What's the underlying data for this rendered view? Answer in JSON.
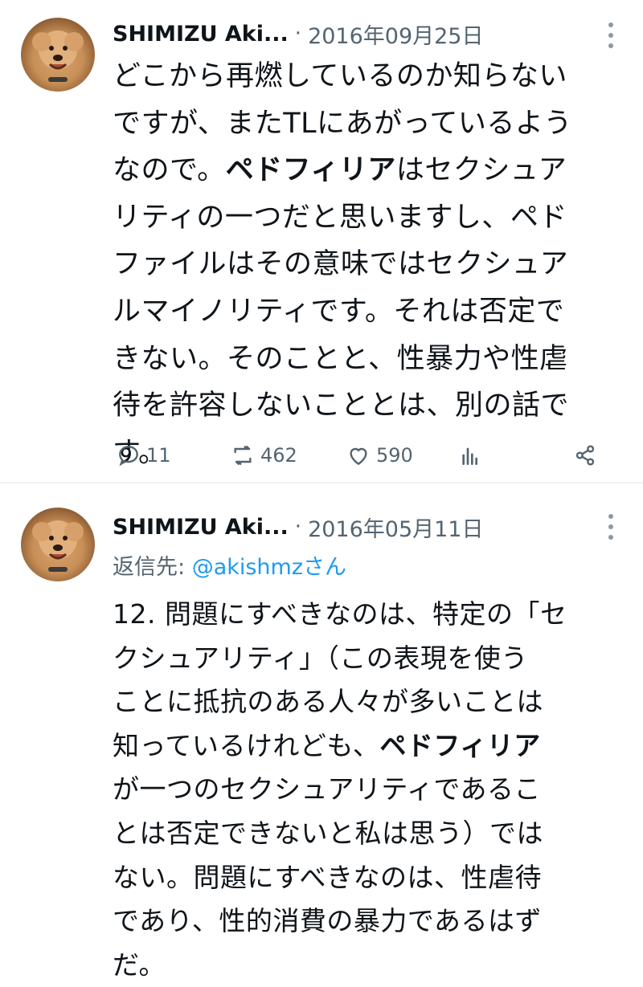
{
  "tweets": [
    {
      "author": "SHIMIZU Aki...",
      "separator": "·",
      "date": "2016年09月25日",
      "body_lines": [
        "どこから再燃しているのか知らない",
        "ですが、またTLにあがっているよう",
        "なので。ペドフィリアはセクシュア",
        "リティの一つだと思いますし、ペド",
        "ファイルはその意味ではセクシュア",
        "ルマイノリティです。それは否定で",
        "きない。そのことと、性暴力や性虐",
        "待を許容しないこととは、別の話で",
        "す。"
      ],
      "actions": {
        "replies": "11",
        "retweets": "462",
        "likes": "590"
      },
      "icons": [
        "reply-icon",
        "retweet-icon",
        "like-icon",
        "views-icon",
        "share-icon",
        "more-icon"
      ]
    },
    {
      "author": "SHIMIZU Aki...",
      "separator": "·",
      "date": "2016年05月11日",
      "reply_prefix": "返信先: ",
      "reply_handle": "@akishmzさん",
      "body_lines": [
        "12. 問題にすべきなのは、特定の「セ",
        "クシュアリティ」（この表現を使う",
        "ことに抵抗のある人々が多いことは",
        "知っているけれども、ペドフィリア",
        "が一つのセクシュアリティであるこ",
        "とは否定できないと私は思う）では",
        "ない。問題にすべきなのは、性虐待",
        "であり、性的消費の暴力であるはず",
        "だ。"
      ]
    }
  ],
  "colors": {
    "text": "#0f1419",
    "muted": "#536471",
    "link": "#1d9bf0",
    "divider": "#eff3f4"
  }
}
